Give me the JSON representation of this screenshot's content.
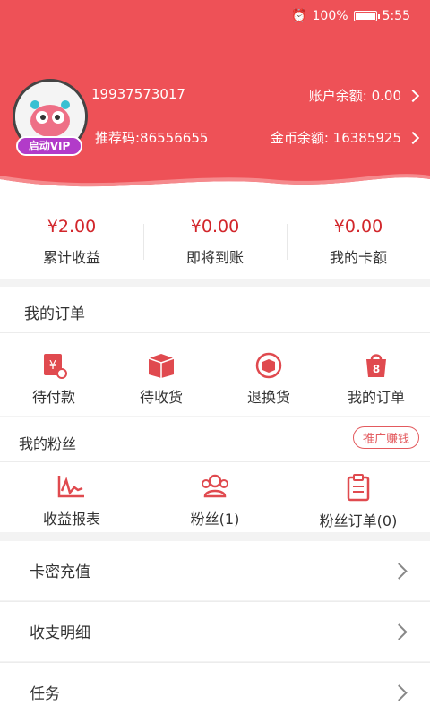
{
  "status_bar": {
    "battery": "100%",
    "time": "5:55"
  },
  "profile": {
    "phone": "19937573017",
    "referral": "推荐码:86556655",
    "vip_badge": "启动VIP",
    "account_balance": "账户余额: 0.00",
    "gold_balance": "金币余额: 16385925"
  },
  "stats": [
    {
      "amount": "¥2.00",
      "label": "累计收益"
    },
    {
      "amount": "¥0.00",
      "label": "即将到账"
    },
    {
      "amount": "¥0.00",
      "label": "我的卡额"
    }
  ],
  "orders": {
    "title": "我的订单",
    "items": [
      {
        "icon": "payment-pending-icon",
        "label": "待付款"
      },
      {
        "icon": "box-icon",
        "label": "待收货"
      },
      {
        "icon": "exchange-icon",
        "label": "退换货"
      },
      {
        "icon": "shopping-bag-icon",
        "label": "我的订单"
      }
    ]
  },
  "fans": {
    "title": "我的粉丝",
    "promo": "推广赚钱",
    "items": [
      {
        "icon": "chart-icon",
        "label": "收益报表"
      },
      {
        "icon": "users-icon",
        "label": "粉丝(1)"
      },
      {
        "icon": "clipboard-icon",
        "label": "粉丝订单(0)"
      }
    ]
  },
  "menu": [
    {
      "label": "卡密充值"
    },
    {
      "label": "收支明细"
    },
    {
      "label": "任务"
    }
  ],
  "colors": {
    "brand": "#ee5157",
    "price": "#d2262b"
  }
}
